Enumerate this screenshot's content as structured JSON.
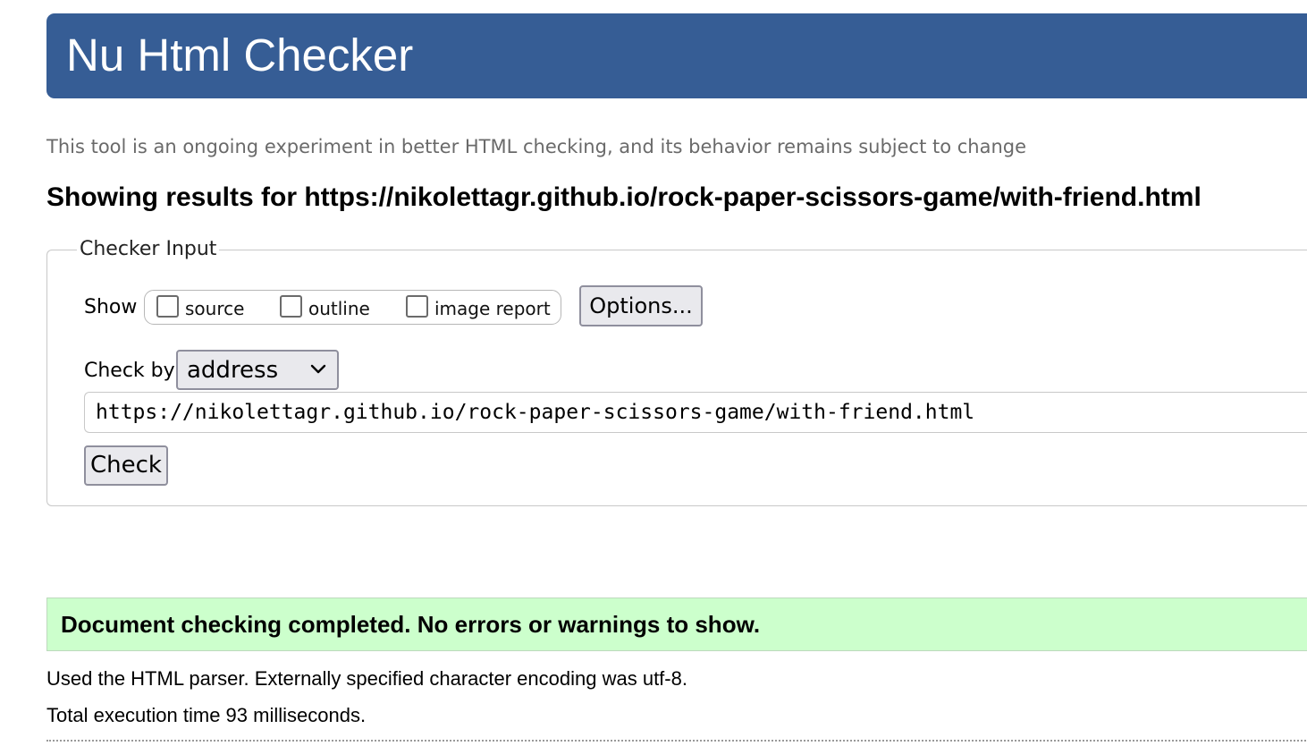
{
  "header": {
    "title": "Nu Html Checker"
  },
  "intro": "This tool is an ongoing experiment in better HTML checking, and its behavior remains subject to change",
  "results_heading": "Showing results for https://nikolettagr.github.io/rock-paper-scissors-game/with-friend.html",
  "checker_input": {
    "legend": "Checker Input",
    "show_label": "Show",
    "show_options": [
      {
        "label": "source",
        "checked": false
      },
      {
        "label": "outline",
        "checked": false
      },
      {
        "label": "image report",
        "checked": false
      }
    ],
    "options_button": "Options...",
    "check_by_label": "Check by",
    "check_by_value": "address",
    "url_value": "https://nikolettagr.github.io/rock-paper-scissors-game/with-friend.html",
    "check_button": "Check"
  },
  "result": {
    "message": "Document checking completed. No errors or warnings to show.",
    "parser_info": "Used the HTML parser. Externally specified character encoding was utf-8.",
    "execution_time": "Total execution time 93 milliseconds."
  },
  "colors": {
    "header_bg": "#365d95",
    "success_bg": "#ccffcc",
    "intro_text": "#6a6a6a"
  }
}
